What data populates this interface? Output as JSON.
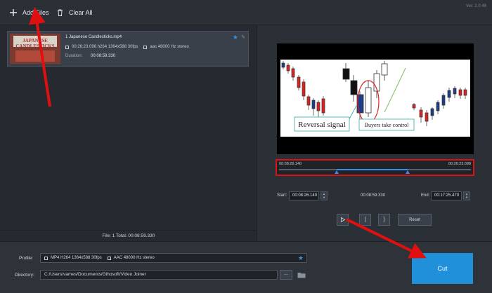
{
  "app": {
    "version": "Ver: 2.0.48"
  },
  "toolbar": {
    "add_files_label": "Add Files",
    "clear_all_label": "Clear All"
  },
  "file_list": {
    "items": [
      {
        "thumbnail_text": "JAPANESE CANDLESTICKS",
        "name": "1 Japanese Candlesticks.mp4",
        "video_info": "00:26:23.098 h264 1364x588 30fps",
        "audio_info": "aac 48000 Hz stereo",
        "duration_label": "Duration:",
        "duration_value": "00:08:59.330"
      }
    ],
    "footer": "File: 1   Total: 00:08:59.330"
  },
  "preview": {
    "annotation_left": "Reversal signal",
    "annotation_right": "Buyers take control"
  },
  "timeline": {
    "start_time": "00:08:26.140",
    "end_time": "00:26:23.098",
    "selection_start_fraction": 0.3,
    "selection_end_fraction": 0.67
  },
  "trim": {
    "start_label": "Start:",
    "start_value": "00:08:26.140",
    "duration_value": "00:08:59.330",
    "end_label": "End:",
    "end_value": "00:17:25.470"
  },
  "controls": {
    "play_icon": "play-icon",
    "mark_in_label": "[",
    "mark_out_label": "]",
    "reset_label": "Reset"
  },
  "output": {
    "profile_label": "Profile:",
    "profile_video": "MP4 H264 1364x588 30fps",
    "profile_audio": "AAC 48000 Hz stereo",
    "directory_label": "Directory:",
    "directory_value": "C:/Users/vames/Documents/Gihosoft/Video Joiner",
    "browse_label": "...",
    "cut_label": "Cut"
  },
  "colors": {
    "accent": "#1f90d9",
    "highlight_red": "#d81414"
  }
}
